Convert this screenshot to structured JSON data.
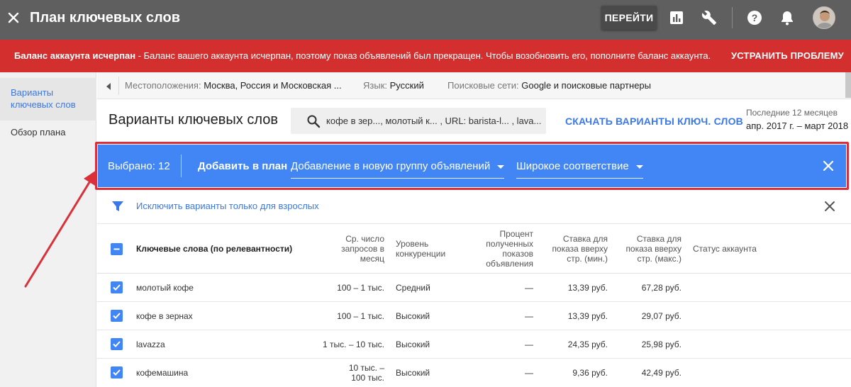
{
  "header": {
    "title": "План ключевых слов",
    "goto_label": "ПЕРЕЙТИ",
    "icons": [
      "close-icon",
      "bar-chart-icon",
      "wrench-icon",
      "help-icon",
      "bell-icon"
    ]
  },
  "alert": {
    "bold": "Баланс аккаунта исчерпан",
    "text": " - Баланс вашего аккаунта исчерпан, поэтому показ объявлений был прекращен. Чтобы возобновить его, пополните баланс аккаунта.",
    "action": "УСТРАНИТЬ ПРОБЛЕМУ",
    "color": "#d32f2f"
  },
  "sidebar": {
    "items": [
      {
        "label": "Варианты ключевых слов",
        "active": true
      },
      {
        "label": "Обзор плана",
        "active": false
      }
    ]
  },
  "filters": {
    "location_label": "Местоположения:",
    "location_value": "Москва, Россия и Московская ...",
    "language_label": "Язык:",
    "language_value": "Русский",
    "networks_label": "Поисковые сети:",
    "networks_value": "Google и поисковые партнеры"
  },
  "section": {
    "title": "Варианты ключевых слов",
    "search_text": "кофе в зер..., молотый к... , URL: barista-l... , lava...",
    "download_label": "СКАЧАТЬ ВАРИАНТЫ КЛЮЧ. СЛОВ",
    "period_label": "Последние 12 месяцев",
    "period_value": "апр. 2017 г. – март 2018"
  },
  "selection": {
    "count_label": "Выбрано: 12",
    "add_label": "Добавить в план",
    "group_dropdown": "Добавление в новую группу объявлений",
    "match_dropdown": "Широкое соответствие",
    "accent": "#4285f4"
  },
  "adult_filter": {
    "label": "Исключить варианты только для взрослых"
  },
  "table": {
    "headers": {
      "keyword": "Ключевые слова (по релевантности)",
      "searches": [
        "Ср. число",
        "запросов в",
        "месяц"
      ],
      "competition": [
        "Уровень",
        "конкуренции"
      ],
      "impression_share": [
        "Процент",
        "полученных",
        "показов",
        "объявления"
      ],
      "bid_low": [
        "Ставка для",
        "показа вверху",
        "стр. (мин.)"
      ],
      "bid_high": [
        "Ставка для",
        "показа вверху",
        "стр. (макс.)"
      ],
      "status": "Статус аккаунта"
    },
    "rows": [
      {
        "keyword": "молотый кофе",
        "searches": "100 – 1 тыс.",
        "competition": "Средний",
        "share": "—",
        "bid_low": "13,39 руб.",
        "bid_high": "67,28 руб."
      },
      {
        "keyword": "кофе в зернах",
        "searches": "100 – 1 тыс.",
        "competition": "Высокий",
        "share": "—",
        "bid_low": "13,39 руб.",
        "bid_high": "29,07 руб."
      },
      {
        "keyword": "lavazza",
        "searches": "1 тыс. – 10 тыс.",
        "competition": "Высокий",
        "share": "—",
        "bid_low": "24,35 руб.",
        "bid_high": "25,98 руб."
      },
      {
        "keyword": "кофемашина",
        "searches_line1": "10 тыс. –",
        "searches_line2": "100 тыс.",
        "competition": "Высокий",
        "share": "—",
        "bid_low": "9,36 руб.",
        "bid_high": "42,49 руб."
      }
    ]
  }
}
